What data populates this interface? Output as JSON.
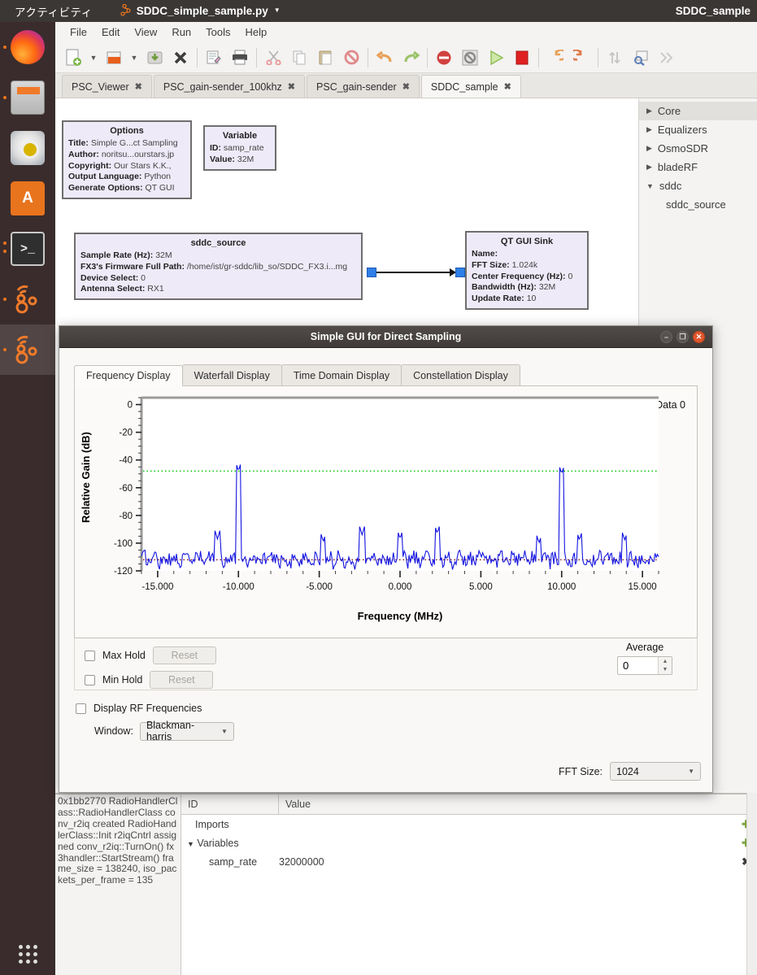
{
  "top_panel": {
    "activities": "アクティビティ",
    "app_icon": "grc-icon",
    "window_menu": "SDDC_simple_sample.py",
    "right_title": "SDDC_sample"
  },
  "launcher": {
    "items": [
      {
        "name": "firefox",
        "label": "Firefox",
        "running": true,
        "selected": false
      },
      {
        "name": "files",
        "label": "Files",
        "running": true,
        "selected": false
      },
      {
        "name": "rhythmbox",
        "label": "Rhythmbox",
        "running": false,
        "selected": false
      },
      {
        "name": "software",
        "label": "Ubuntu Software",
        "running": false,
        "selected": false
      },
      {
        "name": "terminal",
        "label": "Terminal",
        "running": true,
        "selected": false
      },
      {
        "name": "gnuradio-1",
        "label": "GNU Radio Companion",
        "running": true,
        "selected": false
      },
      {
        "name": "gnuradio-2",
        "label": "GNU Radio Companion",
        "running": true,
        "selected": true
      }
    ],
    "show_apps": "show-applications"
  },
  "grc": {
    "menubar": [
      "File",
      "Edit",
      "View",
      "Run",
      "Tools",
      "Help"
    ],
    "toolbar": [
      {
        "name": "new-file",
        "glyph": "🗋"
      },
      {
        "name": "new-file-dropdown",
        "glyph": "▾"
      },
      {
        "name": "open-file",
        "glyph": "🗀"
      },
      {
        "name": "open-file-dropdown",
        "glyph": "▾"
      },
      {
        "name": "save",
        "glyph": "⤓"
      },
      {
        "name": "close",
        "glyph": "✖"
      },
      {
        "name": "edit-properties",
        "glyph": "🖉"
      },
      {
        "name": "print",
        "glyph": "🖨"
      },
      {
        "name": "cut",
        "glyph": "✂"
      },
      {
        "name": "copy",
        "glyph": "⧉"
      },
      {
        "name": "paste",
        "glyph": "📋"
      },
      {
        "name": "disable-block",
        "glyph": "🚫"
      },
      {
        "name": "undo",
        "glyph": "↩"
      },
      {
        "name": "redo",
        "glyph": "↪"
      },
      {
        "name": "disable",
        "glyph": "⛔"
      },
      {
        "name": "bypass",
        "glyph": "▣"
      },
      {
        "name": "execute-flowgraph",
        "glyph": "▶"
      },
      {
        "name": "kill-flowgraph",
        "glyph": "■"
      },
      {
        "name": "rotate-left",
        "glyph": "↺"
      },
      {
        "name": "rotate-right",
        "glyph": "↻"
      },
      {
        "name": "flip-vertical",
        "glyph": "⇅"
      },
      {
        "name": "find-block",
        "glyph": "🔍"
      },
      {
        "name": "more-tools",
        "glyph": "≫"
      }
    ],
    "tabs": [
      {
        "label": "PSC_Viewer",
        "active": false
      },
      {
        "label": "PSC_gain-sender_100khz",
        "active": false
      },
      {
        "label": "PSC_gain-sender",
        "active": false
      },
      {
        "label": "SDDC_sample",
        "active": true
      }
    ],
    "blocks": [
      {
        "name": "options-block",
        "title": "Options",
        "rows": [
          {
            "key": "Title:",
            "value": "Simple G...ct Sampling"
          },
          {
            "key": "Author:",
            "value": "noritsu...ourstars.jp"
          },
          {
            "key": "Copyright:",
            "value": "Our Stars K.K.,"
          },
          {
            "key": "Output Language:",
            "value": "Python"
          },
          {
            "key": "Generate Options:",
            "value": "QT GUI"
          }
        ]
      },
      {
        "name": "variable-block",
        "title": "Variable",
        "rows": [
          {
            "key": "ID:",
            "value": "samp_rate"
          },
          {
            "key": "Value:",
            "value": "32M"
          }
        ]
      },
      {
        "name": "sddc-source-block",
        "title": "sddc_source",
        "rows": [
          {
            "key": "Sample Rate (Hz):",
            "value": "32M"
          },
          {
            "key": "FX3's Firmware Full Path:",
            "value": "/home/ist/gr-sddc/lib_so/SDDC_FX3.i...mg"
          },
          {
            "key": "Device Select:",
            "value": "0"
          },
          {
            "key": "Antenna Select:",
            "value": "RX1"
          }
        ]
      },
      {
        "name": "qt-gui-sink-block",
        "title": "QT GUI Sink",
        "rows": [
          {
            "key": "Name:",
            "value": ""
          },
          {
            "key": "FFT Size:",
            "value": "1.024k"
          },
          {
            "key": "Center Frequency (Hz):",
            "value": "0"
          },
          {
            "key": "Bandwidth (Hz):",
            "value": "32M"
          },
          {
            "key": "Update Rate:",
            "value": "10"
          }
        ]
      }
    ],
    "block_library": [
      {
        "label": "Core",
        "expanded": false,
        "child": false,
        "selected": true
      },
      {
        "label": "Equalizers",
        "expanded": false,
        "child": false,
        "selected": false
      },
      {
        "label": "OsmoSDR",
        "expanded": false,
        "child": false,
        "selected": false
      },
      {
        "label": "bladeRF",
        "expanded": false,
        "child": false,
        "selected": false
      },
      {
        "label": "sddc",
        "expanded": true,
        "child": false,
        "selected": false
      },
      {
        "label": "sddc_source",
        "expanded": false,
        "child": true,
        "selected": false
      }
    ],
    "console_text": "0x1bb2770 RadioHandlerClass::RadioHandlerClass conv_r2iq created RadioHandlerClass::Init r2iqCntrl assigned conv_r2iq::TurnOn() fx3handler::StartStream() frame_size = 138240, iso_packets_per_frame = 135",
    "vars_panel": {
      "headers": [
        "ID",
        "Value"
      ],
      "rows": [
        {
          "id": "Imports",
          "value": "",
          "action": "✚",
          "indent": 1,
          "expander": ""
        },
        {
          "id": "Variables",
          "value": "",
          "action": "✚",
          "indent": 2,
          "expander": "▼"
        },
        {
          "id": "samp_rate",
          "value": "32000000",
          "action": "✖",
          "indent": 3,
          "expander": ""
        }
      ]
    }
  },
  "dialog": {
    "title": "Simple GUI for Direct Sampling",
    "window_buttons": [
      {
        "name": "minimize-button",
        "glyph": "−"
      },
      {
        "name": "maximize-button",
        "glyph": "❐"
      },
      {
        "name": "close-button",
        "glyph": "✕"
      }
    ],
    "tabs": [
      {
        "label": "Frequency Display",
        "active": true
      },
      {
        "label": "Waterfall Display",
        "active": false
      },
      {
        "label": "Time Domain Display",
        "active": false
      },
      {
        "label": "Constellation Display",
        "active": false
      }
    ],
    "controls": {
      "max_hold_label": "Max Hold",
      "max_hold_checked": false,
      "max_hold_reset": "Reset",
      "min_hold_label": "Min Hold",
      "min_hold_checked": false,
      "min_hold_reset": "Reset",
      "average_label": "Average",
      "average_value": "0",
      "display_rf_label": "Display RF Frequencies",
      "display_rf_checked": false,
      "window_label": "Window:",
      "window_value": "Blackman-harris",
      "fft_size_label": "FFT Size:",
      "fft_size_value": "1024"
    }
  },
  "chart_data": {
    "type": "line",
    "title": "",
    "xlabel": "Frequency (MHz)",
    "ylabel": "Relative Gain (dB)",
    "xlim": [
      -16.0,
      16.0
    ],
    "ylim": [
      -120,
      5
    ],
    "xticks": [
      -15.0,
      -10.0,
      -5.0,
      0.0,
      5.0,
      10.0,
      15.0
    ],
    "xticklabels": [
      "-15.000",
      "-10.000",
      "-5.000",
      "0.000",
      "5.000",
      "10.000",
      "15.000"
    ],
    "yticks": [
      0,
      -20,
      -40,
      -60,
      -80,
      -100,
      -120
    ],
    "yticklabels": [
      "0",
      "-20",
      "-40",
      "-60",
      "-80",
      "-100",
      "-120"
    ],
    "grid": false,
    "legend": [
      {
        "name": "Data 0",
        "color": "#1414e0",
        "position": "top-right-outside"
      }
    ],
    "series": [
      {
        "name": "Data 0",
        "color": "#1414e0",
        "noise_floor_db": -112,
        "peaks": [
          {
            "freq_mhz": -10.0,
            "level_db": -48
          },
          {
            "freq_mhz": 10.0,
            "level_db": -50
          },
          {
            "freq_mhz": -2.35,
            "level_db": -94
          },
          {
            "freq_mhz": 0.0,
            "level_db": -97
          },
          {
            "freq_mhz": 2.3,
            "level_db": -93
          },
          {
            "freq_mhz": -11.3,
            "level_db": -97
          },
          {
            "freq_mhz": -4.75,
            "level_db": -99
          },
          {
            "freq_mhz": 8.6,
            "level_db": -100
          },
          {
            "freq_mhz": 11.1,
            "level_db": -98
          },
          {
            "freq_mhz": 13.9,
            "level_db": -98
          }
        ]
      }
    ],
    "reference_lines": [
      {
        "name": "max-line",
        "value_db": -48,
        "color": "#00c000",
        "style": "dotted"
      },
      {
        "name": "min-line",
        "value_db": -112,
        "color": "#8b2222",
        "style": "dotted"
      }
    ]
  }
}
